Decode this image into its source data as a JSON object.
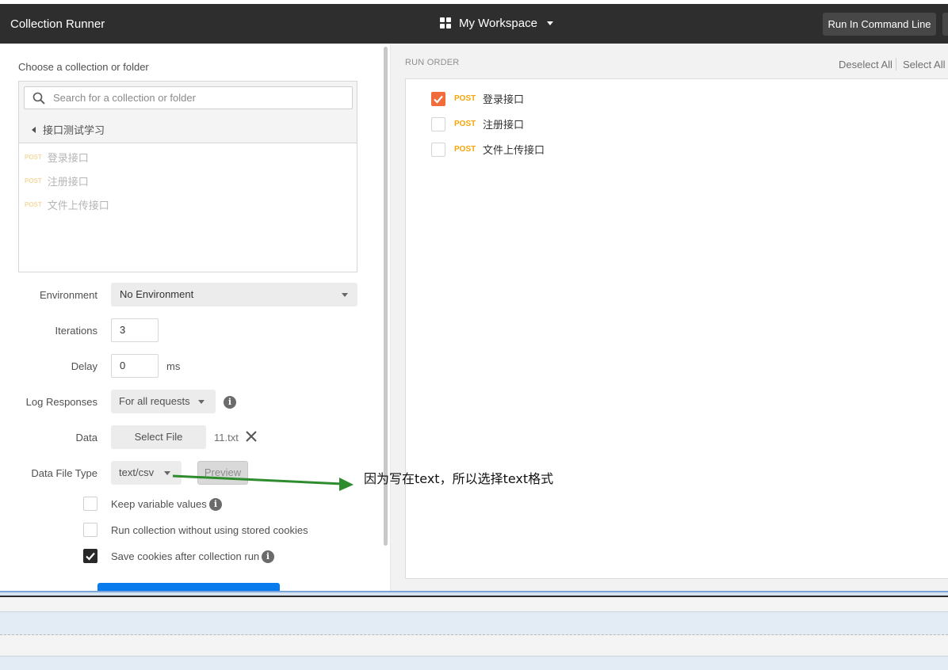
{
  "titlebar": {
    "app_title": "Collection Runner",
    "workspace": "My Workspace",
    "run_cmd_label": "Run In Command Line"
  },
  "left": {
    "choose_label": "Choose a collection or folder",
    "search_placeholder": "Search for a collection or folder",
    "folder_name": "接口测试学习",
    "requests": [
      {
        "method": "POST",
        "name": "登录接口"
      },
      {
        "method": "POST",
        "name": "注册接口"
      },
      {
        "method": "POST",
        "name": "文件上传接口"
      }
    ],
    "environment": {
      "label": "Environment",
      "value": "No Environment"
    },
    "iterations": {
      "label": "Iterations",
      "value": "3"
    },
    "delay": {
      "label": "Delay",
      "value": "0",
      "unit": "ms"
    },
    "log_responses": {
      "label": "Log Responses",
      "value": "For all requests"
    },
    "data": {
      "label": "Data",
      "button": "Select File",
      "file_name": "11.txt"
    },
    "data_file_type": {
      "label": "Data File Type",
      "value": "text/csv",
      "preview": "Preview"
    },
    "options": {
      "keep_variable_values": {
        "label": "Keep variable values",
        "checked": false
      },
      "run_without_cookies": {
        "label": "Run collection without using stored cookies",
        "checked": false
      },
      "save_cookies": {
        "label": "Save cookies after collection run",
        "checked": true
      }
    }
  },
  "right": {
    "run_order_label": "RUN ORDER",
    "deselect_all": "Deselect All",
    "select_all": "Select All",
    "items": [
      {
        "method": "POST",
        "name": "登录接口",
        "checked": true
      },
      {
        "method": "POST",
        "name": "注册接口",
        "checked": false
      },
      {
        "method": "POST",
        "name": "文件上传接口",
        "checked": false
      }
    ]
  },
  "annotation": {
    "text": "因为写在text，所以选择text格式",
    "color": "#2e8b2e"
  },
  "colors": {
    "titlebar": "#2e2e2e",
    "accent_orange": "#f26b3a",
    "method_post": "#f4a60b",
    "run_button": "#097bed"
  }
}
